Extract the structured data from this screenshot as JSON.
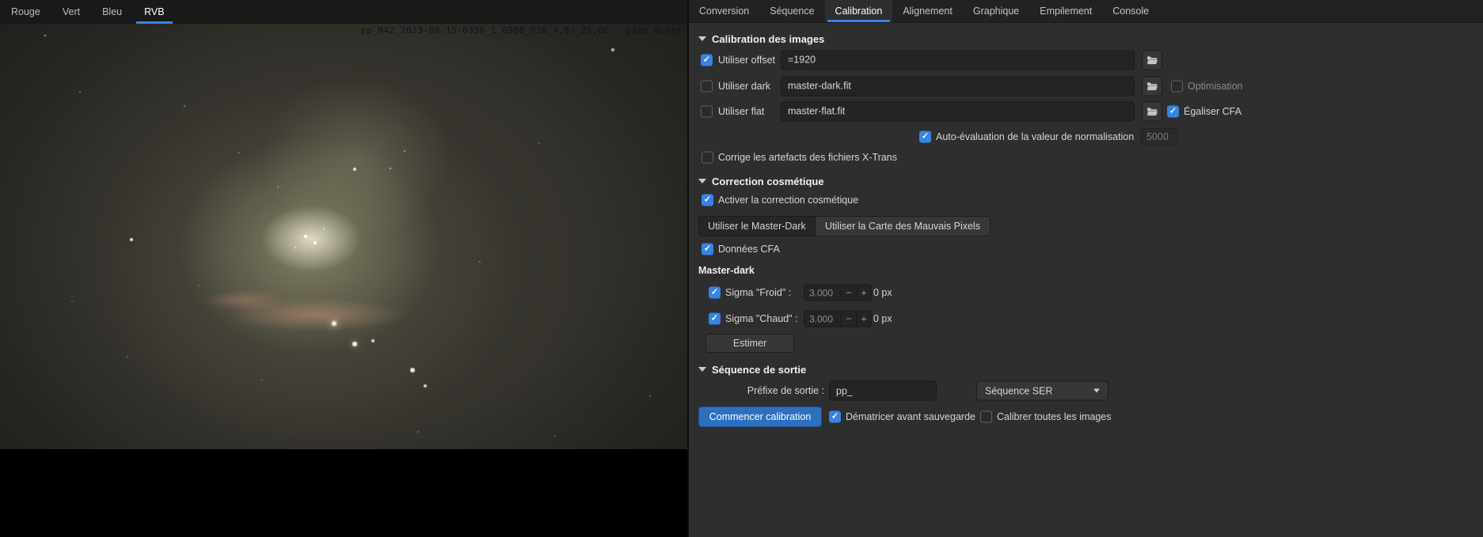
{
  "viewer": {
    "tabs": [
      {
        "label": "Rouge"
      },
      {
        "label": "Vert"
      },
      {
        "label": "Bleu"
      },
      {
        "label": "RVB"
      }
    ],
    "active_tab": "RVB",
    "filename": "pp_M42_2023-08-15-0336_1_G300_O30_4,0s_26,6C___pipp_0.ser"
  },
  "panel": {
    "tabs": [
      {
        "label": "Conversion"
      },
      {
        "label": "Séquence"
      },
      {
        "label": "Calibration"
      },
      {
        "label": "Alignement"
      },
      {
        "label": "Graphique"
      },
      {
        "label": "Empilement"
      },
      {
        "label": "Console"
      }
    ],
    "active_tab": "Calibration",
    "calibration": {
      "title": "Calibration des images",
      "offset_label": "Utiliser offset",
      "offset_checked": true,
      "offset_value": "=1920",
      "dark_label": "Utiliser dark",
      "dark_checked": false,
      "dark_value": "master-dark.fit",
      "optimisation_label": "Optimisation",
      "optimisation_checked": false,
      "flat_label": "Utiliser flat",
      "flat_checked": false,
      "flat_value": "master-flat.fit",
      "egaliser_label": "Égaliser CFA",
      "egaliser_checked": true,
      "autoeval_label": "Auto-évaluation de la valeur de normalisation",
      "autoeval_checked": true,
      "autoeval_value": "5000",
      "xtrans_label": "Corrige les artefacts des fichiers X-Trans",
      "xtrans_checked": false
    },
    "cosmetic": {
      "title": "Correction cosmétique",
      "enable_label": "Activer la correction cosmétique",
      "enable_checked": true,
      "mode_masterdark_label": "Utiliser le Master-Dark",
      "mode_badpixels_label": "Utiliser la Carte des Mauvais Pixels",
      "cfa_label": "Données CFA",
      "cfa_checked": true,
      "masterdark_title": "Master-dark",
      "sigma_cold_label": "Sigma \"Froid\" :",
      "sigma_cold_checked": true,
      "sigma_cold_value": "3.000",
      "sigma_cold_px": "0 px",
      "sigma_hot_label": "Sigma \"Chaud\" :",
      "sigma_hot_checked": true,
      "sigma_hot_value": "3.000",
      "sigma_hot_px": "0 px",
      "estimate_label": "Estimer"
    },
    "output": {
      "title": "Séquence de sortie",
      "prefix_label": "Préfixe de sortie :",
      "prefix_value": "pp_",
      "sequence_type_value": "Séquence SER",
      "start_label": "Commencer calibration",
      "demosaic_label": "Dématricer avant sauvegarde",
      "demosaic_checked": true,
      "calibrate_all_label": "Calibrer toutes les images",
      "calibrate_all_checked": false
    }
  },
  "colors": {
    "accent": "#3584e4",
    "start_button": "#2d6fc0"
  }
}
